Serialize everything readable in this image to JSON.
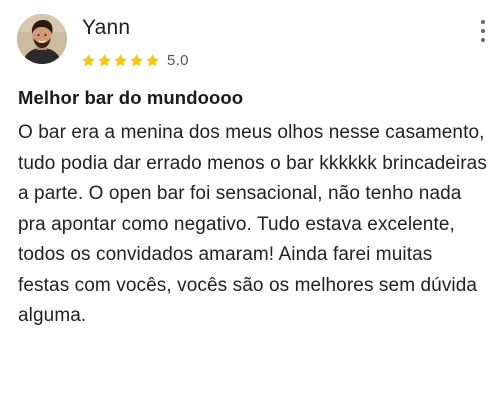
{
  "review": {
    "author": "Yann",
    "rating": 5,
    "rating_label": "5.0",
    "star_color": "#f5c518",
    "title": "Melhor bar do mundoooo",
    "body": "O bar era a menina dos meus olhos nesse casamento, tudo podia dar errado menos o bar kkkkkk brincadeiras a parte. O open bar foi sensacional, não tenho nada pra apontar como negativo. Tudo estava excelente, todos os convidados amaram! Ainda farei muitas festas com vocês, vocês são os melhores sem dúvida alguma.",
    "menu_icon": "more-vertical-icon"
  }
}
